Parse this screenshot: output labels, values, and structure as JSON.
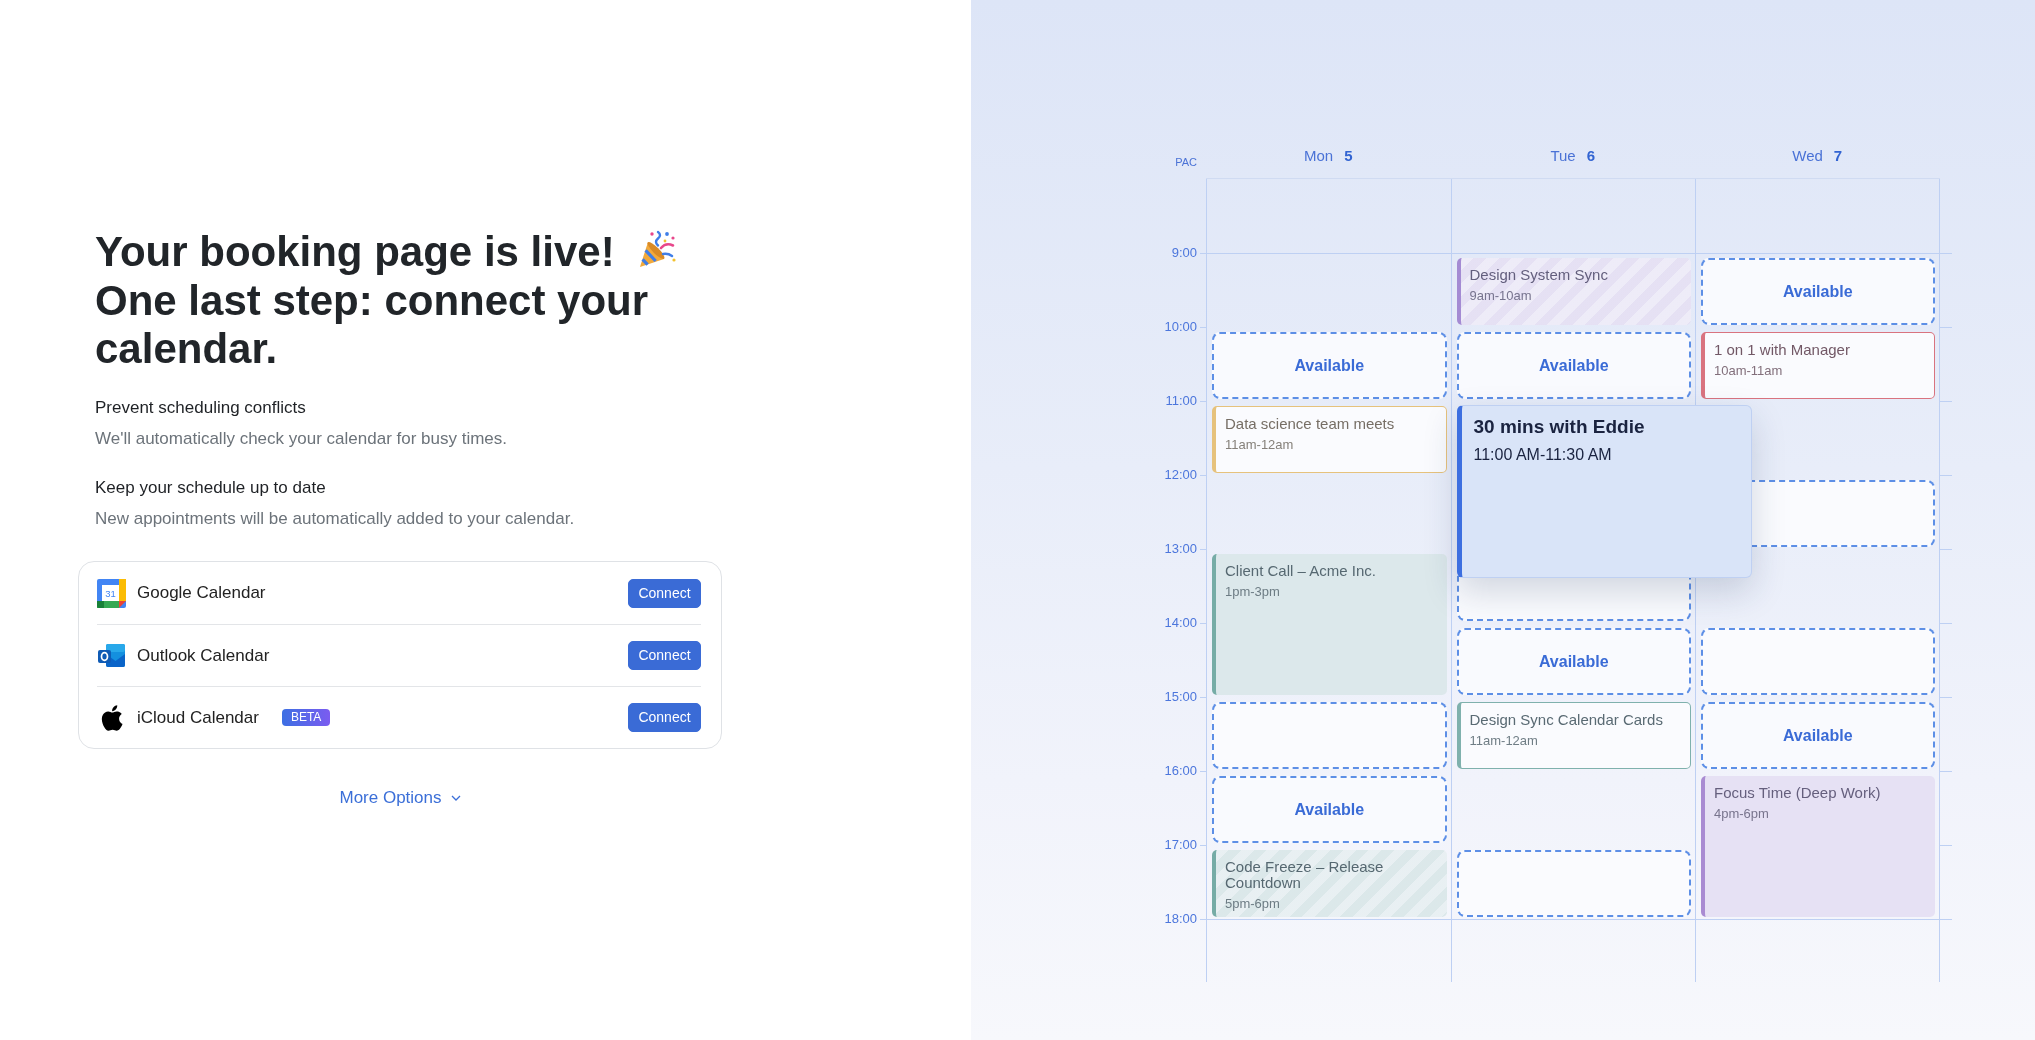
{
  "intro": {
    "title": "Your booking page is live!",
    "subtitle": "One last step: connect your calendar."
  },
  "benefits": [
    {
      "title": "Prevent scheduling conflicts",
      "text": "We'll automatically check your calendar for busy times."
    },
    {
      "title": "Keep your schedule up to date",
      "text": "New appointments will be automatically added to your calendar."
    }
  ],
  "providers": [
    {
      "kind": "google",
      "name": "Google Calendar",
      "logo_text": "31",
      "button": "Connect"
    },
    {
      "kind": "outlook",
      "name": "Outlook Calendar",
      "button": "Connect"
    },
    {
      "kind": "icloud",
      "name": "iCloud Calendar",
      "badge": "BETA",
      "button": "Connect"
    }
  ],
  "more_options": "More Options",
  "calendar": {
    "timezone": "PAC",
    "days": [
      {
        "weekday": "Mon",
        "date": "5",
        "slots": [
          {
            "kind": "empty"
          },
          {
            "kind": "empty"
          },
          {
            "kind": "available",
            "tall": false,
            "label": "Available"
          },
          {
            "kind": "outlined",
            "tall": false,
            "title": "Data science team meets",
            "time": "11am-12am",
            "color": "#e6c27c"
          },
          {
            "kind": "empty"
          },
          {
            "kind": "filled",
            "tall": true,
            "title": "Client Call – Acme Inc.",
            "time": "1pm-3pm",
            "color": "#76aca6"
          },
          {
            "kind": "open",
            "tall": false
          },
          {
            "kind": "available",
            "tall": false,
            "label": "Available"
          },
          {
            "kind": "striped",
            "tall": false,
            "title": "Code Freeze – Release Countdown",
            "time": "5pm-6pm",
            "color": "#76aca6"
          }
        ]
      },
      {
        "weekday": "Tue",
        "date": "6",
        "slots": [
          {
            "kind": "empty"
          },
          {
            "kind": "striped",
            "tall": false,
            "title": "Design System Sync",
            "time": "9am-10am",
            "color": "#a48bd3"
          },
          {
            "kind": "available",
            "tall": false,
            "label": "Available"
          },
          {
            "kind": "preview",
            "tall": false,
            "title": "30 mins with Eddie",
            "time": "11:00 AM-11:30 AM",
            "color": "#3d6fe0"
          },
          {
            "kind": "empty"
          },
          {
            "kind": "open",
            "tall": false
          },
          {
            "kind": "available",
            "tall": false,
            "label": "Available"
          },
          {
            "kind": "outlined",
            "tall": false,
            "title": "Design Sync Calendar Cards",
            "time": "11am-12am",
            "color": "#7fb1ad"
          },
          {
            "kind": "empty"
          },
          {
            "kind": "open",
            "tall": false
          }
        ]
      },
      {
        "weekday": "Wed",
        "date": "7",
        "slots": [
          {
            "kind": "empty"
          },
          {
            "kind": "available",
            "tall": false,
            "label": "Available"
          },
          {
            "kind": "outlined",
            "tall": false,
            "title": "1 on 1 with Manager",
            "time": "10am-11am",
            "color": "#d9737f"
          },
          {
            "kind": "empty"
          },
          {
            "kind": "open",
            "tall": false
          },
          {
            "kind": "empty"
          },
          {
            "kind": "open",
            "tall": false
          },
          {
            "kind": "available",
            "tall": false,
            "label": "Available"
          },
          {
            "kind": "filled",
            "tall": true,
            "title": "Focus Time (Deep Work)",
            "time": "4pm-6pm",
            "color": "#a98bd2"
          }
        ]
      }
    ],
    "hours": [
      "9:00",
      "10:00",
      "11:00",
      "12:00",
      "13:00",
      "14:00",
      "15:00",
      "16:00",
      "17:00",
      "18:00"
    ]
  }
}
